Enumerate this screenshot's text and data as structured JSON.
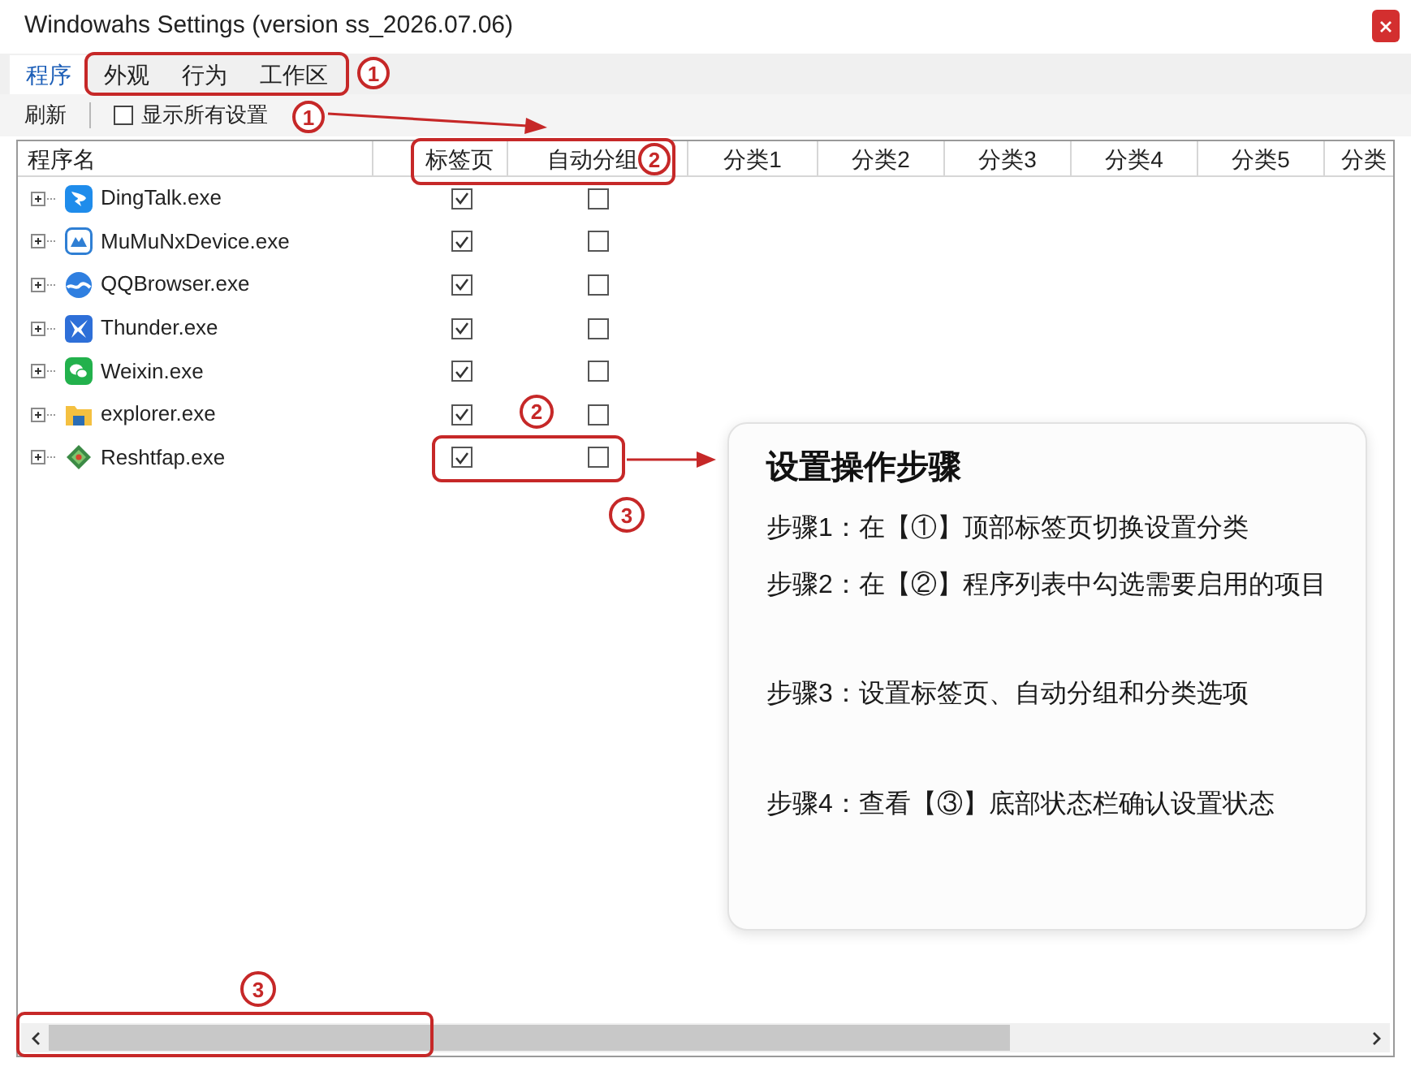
{
  "window": {
    "title": "Windowahs Settings (version ss_2026.07.06)"
  },
  "tabs": [
    {
      "label": "程序",
      "selected": true
    },
    {
      "label": "外观",
      "selected": false
    },
    {
      "label": "行为",
      "selected": false
    },
    {
      "label": "工作区",
      "selected": false
    }
  ],
  "toolbar": {
    "refresh": "刷新",
    "show_all": {
      "label": "显示所有设置",
      "checked": false
    }
  },
  "table": {
    "columns": [
      "程序名",
      "标签页",
      "自动分组",
      "分类1",
      "分类2",
      "分类3",
      "分类4",
      "分类5",
      "分类"
    ],
    "rows": [
      {
        "name": "DingTalk.exe",
        "expanded": false,
        "tab_page": true,
        "auto_group": false
      },
      {
        "name": "MuMuNxDevice.exe",
        "expanded": false,
        "tab_page": true,
        "auto_group": false
      },
      {
        "name": "QQBrowser.exe",
        "expanded": false,
        "tab_page": true,
        "auto_group": false
      },
      {
        "name": "Thunder.exe",
        "expanded": false,
        "tab_page": true,
        "auto_group": false
      },
      {
        "name": "Weixin.exe",
        "expanded": false,
        "tab_page": true,
        "auto_group": false
      },
      {
        "name": "explorer.exe",
        "expanded": false,
        "tab_page": true,
        "auto_group": false
      },
      {
        "name": "Reshtfap.exe",
        "expanded": false,
        "tab_page": true,
        "auto_group": false
      }
    ]
  },
  "annotations": {
    "markers": [
      "1",
      "1",
      "2",
      "2",
      "3",
      "3"
    ]
  },
  "guide": {
    "title": "设置操作步骤",
    "steps": [
      "步骤1：在【①】顶部标签页切换设置分类",
      "步骤2：在【②】程序列表中勾选需要启用的项目",
      "步骤3：设置标签页、自动分组和分类选项",
      "步骤4：查看【③】底部状态栏确认设置状态"
    ]
  }
}
